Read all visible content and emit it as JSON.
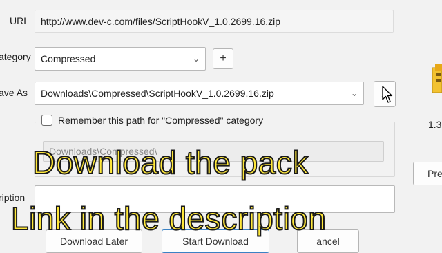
{
  "form": {
    "url_label": "URL",
    "url_value": "http://www.dev-c.com/files/ScriptHookV_1.0.2699.16.zip",
    "category_label": "ategory",
    "category_value": "Compressed",
    "add_category_label": "+",
    "saveas_label": "ave As",
    "saveas_value": "Downloads\\Compressed\\ScriptHookV_1.0.2699.16.zip",
    "browse_label": "...",
    "remember_label": "Remember this path for \"Compressed\" category",
    "remember_path_value": "Downloads\\Compressed\\",
    "description_label": "ription"
  },
  "buttons": {
    "download_later": "Download Later",
    "start_download": "Start Download",
    "cancel": "ancel"
  },
  "side": {
    "size_text": "1.3",
    "pre_button": "Pre"
  },
  "overlay": {
    "line1": "Download the pack",
    "line2": "Link in the description"
  },
  "colors": {
    "caption_fill": "#ffe83a",
    "caption_outline": "#1a1a1a"
  }
}
